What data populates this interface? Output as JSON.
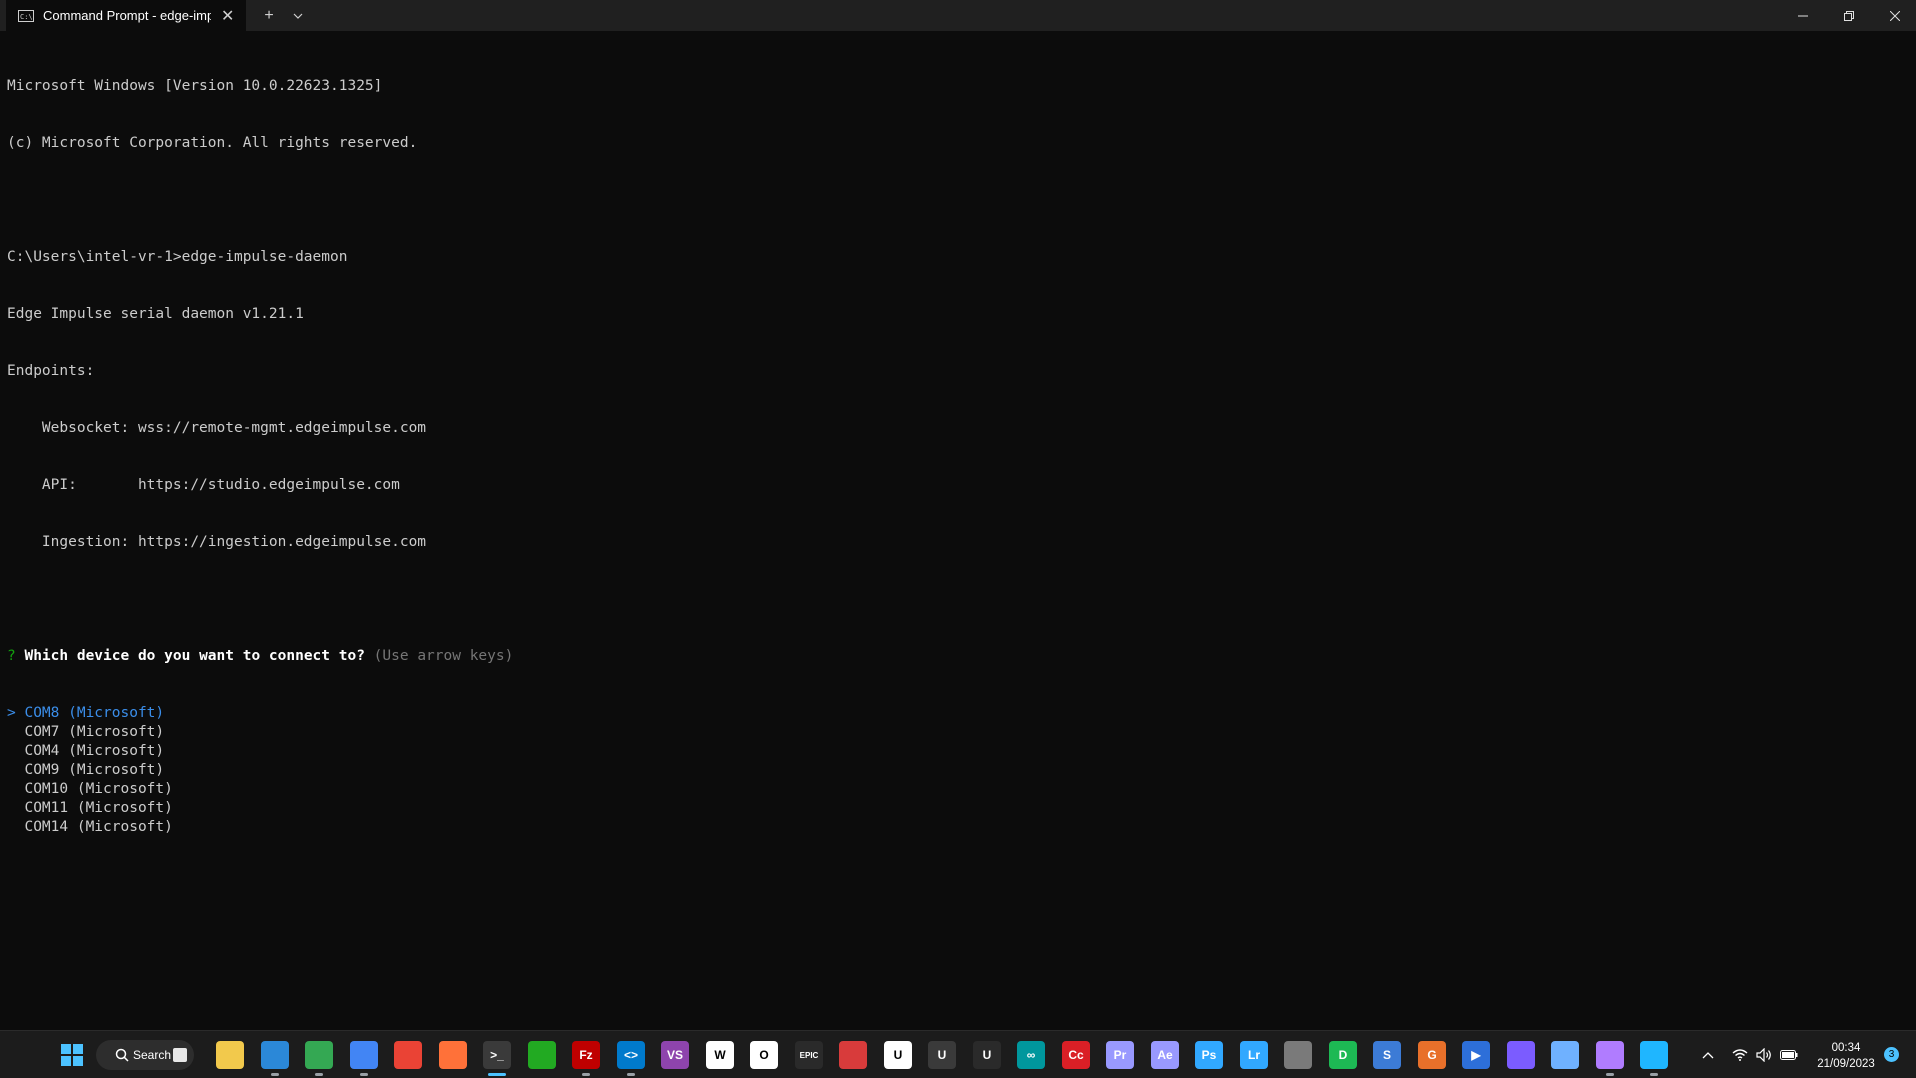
{
  "window": {
    "tab_title": "Command Prompt - edge-imp",
    "tab_close_glyph": "✕",
    "new_tab_glyph": "+",
    "tab_dropdown_glyph": "⌄"
  },
  "terminal": {
    "lines": [
      "Microsoft Windows [Version 10.0.22623.1325]",
      "(c) Microsoft Corporation. All rights reserved.",
      "",
      "C:\\Users\\intel-vr-1>edge-impulse-daemon",
      "Edge Impulse serial daemon v1.21.1",
      "Endpoints:",
      "    Websocket: wss://remote-mgmt.edgeimpulse.com",
      "    API:       https://studio.edgeimpulse.com",
      "    Ingestion: https://ingestion.edgeimpulse.com",
      ""
    ],
    "prompt": {
      "marker": "?",
      "question": "Which device do you want to connect to?",
      "hint": "(Use arrow keys)"
    },
    "choices": [
      {
        "label": "COM8 (Microsoft)",
        "selected": true,
        "pointer": ">"
      },
      {
        "label": "COM7 (Microsoft)",
        "selected": false,
        "pointer": " "
      },
      {
        "label": "COM4 (Microsoft)",
        "selected": false,
        "pointer": " "
      },
      {
        "label": "COM9 (Microsoft)",
        "selected": false,
        "pointer": " "
      },
      {
        "label": "COM10 (Microsoft)",
        "selected": false,
        "pointer": " "
      },
      {
        "label": "COM11 (Microsoft)",
        "selected": false,
        "pointer": " "
      },
      {
        "label": "COM14 (Microsoft)",
        "selected": false,
        "pointer": " "
      }
    ]
  },
  "taskbar": {
    "search_label": "Search",
    "apps": [
      {
        "name": "file-explorer-icon",
        "color": "#f2c94c",
        "text": ""
      },
      {
        "name": "app-globe-icon",
        "color": "#2b88d8",
        "text": ""
      },
      {
        "name": "chrome-icon",
        "color": "#34a853",
        "text": ""
      },
      {
        "name": "chrome-canary-icon",
        "color": "#4285f4",
        "text": ""
      },
      {
        "name": "chrome-dev-icon",
        "color": "#ea4335",
        "text": ""
      },
      {
        "name": "firefox-icon",
        "color": "#ff7139",
        "text": ""
      },
      {
        "name": "terminal-icon",
        "color": "#3a3a3a",
        "text": ">_"
      },
      {
        "name": "green-app-icon",
        "color": "#22aa22",
        "text": ""
      },
      {
        "name": "filezilla-icon",
        "color": "#bf0000",
        "text": "Fz"
      },
      {
        "name": "vscode-icon",
        "color": "#007acc",
        "text": "<>"
      },
      {
        "name": "visual-studio-icon",
        "color": "#8e44ad",
        "text": "VS"
      },
      {
        "name": "app-w-icon",
        "color": "#ffffff",
        "text": "W"
      },
      {
        "name": "oculus-icon",
        "color": "#ffffff",
        "text": "O"
      },
      {
        "name": "epic-games-icon",
        "color": "#2a2a2a",
        "text": "EPIC"
      },
      {
        "name": "red-app-icon",
        "color": "#d83b3b",
        "text": ""
      },
      {
        "name": "unity-icon",
        "color": "#ffffff",
        "text": "U"
      },
      {
        "name": "unity-hub-icon",
        "color": "#3a3a3a",
        "text": "U"
      },
      {
        "name": "unity-dark-icon",
        "color": "#2a2a2a",
        "text": "U"
      },
      {
        "name": "arduino-icon",
        "color": "#00979d",
        "text": "∞"
      },
      {
        "name": "creative-cloud-icon",
        "color": "#da1f26",
        "text": "Cc"
      },
      {
        "name": "premiere-icon",
        "color": "#9999ff",
        "text": "Pr"
      },
      {
        "name": "after-effects-icon",
        "color": "#9999ff",
        "text": "Ae"
      },
      {
        "name": "photoshop-icon",
        "color": "#31a8ff",
        "text": "Ps"
      },
      {
        "name": "lightroom-icon",
        "color": "#31a8ff",
        "text": "Lr"
      },
      {
        "name": "gaming-app-icon",
        "color": "#7a7a7a",
        "text": ""
      },
      {
        "name": "app-d-icon",
        "color": "#1db954",
        "text": "D"
      },
      {
        "name": "app-s-icon",
        "color": "#3c7bd6",
        "text": "S"
      },
      {
        "name": "app-g-icon",
        "color": "#e8702a",
        "text": "G"
      },
      {
        "name": "app-play-icon",
        "color": "#2d6fd9",
        "text": "▶"
      },
      {
        "name": "app-shield-icon",
        "color": "#7b5cff",
        "text": ""
      },
      {
        "name": "app-cube-icon",
        "color": "#6fb1ff",
        "text": ""
      },
      {
        "name": "github-icon",
        "color": "#b07cff",
        "text": ""
      },
      {
        "name": "app-link-icon",
        "color": "#1fb6ff",
        "text": ""
      }
    ],
    "clock": {
      "time": "00:34",
      "date": "21/09/2023"
    },
    "notification_count": "3"
  }
}
